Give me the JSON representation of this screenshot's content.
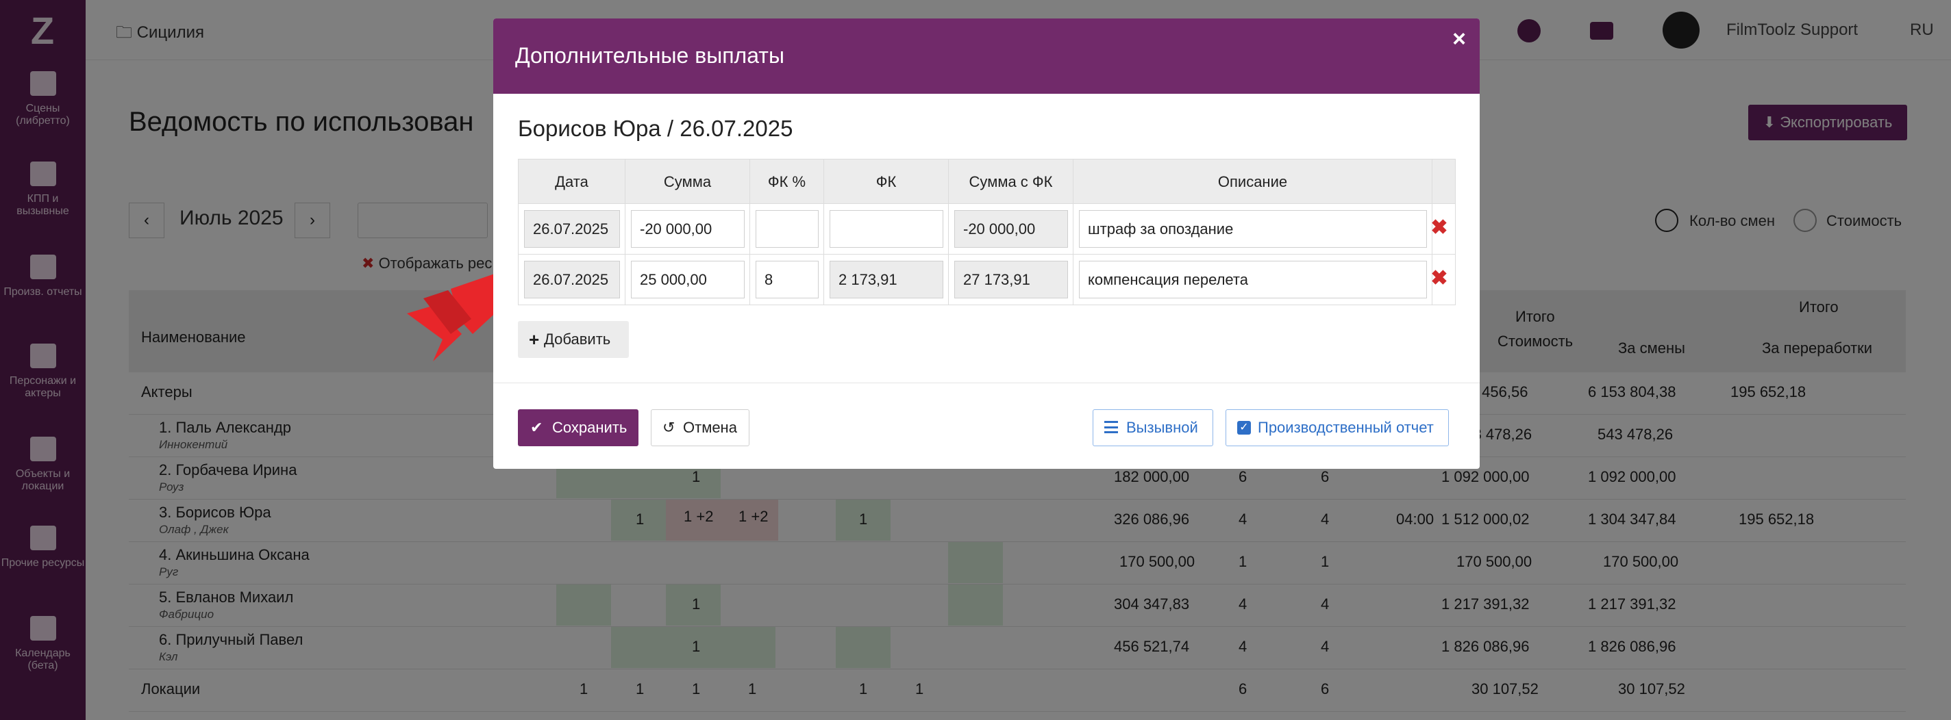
{
  "sidebar": {
    "logo": "Z",
    "items": [
      {
        "label": "Сцены (либретто)",
        "icon": "clapperboard-icon"
      },
      {
        "label": "КПП и вызывные",
        "icon": "calendar-grid-icon"
      },
      {
        "label": "Произв. отчеты",
        "icon": "check-square-icon"
      },
      {
        "label": "Персонажи и актеры",
        "icon": "users-icon"
      },
      {
        "label": "Объекты и локации",
        "icon": "image-icon"
      },
      {
        "label": "Прочие ресурсы",
        "icon": "archive-icon"
      },
      {
        "label": "Календарь (бета)",
        "icon": "calendar-icon"
      }
    ]
  },
  "topbar": {
    "project": "Сицилия",
    "user": "FilmToolz Support",
    "language": "RU"
  },
  "page": {
    "title": "Ведомость по использован",
    "export_label": "Экспортировать",
    "month": "Июль 2025",
    "prev": "‹",
    "next": "›",
    "display_filter": "Отображать рес",
    "radio_shifts": "Кол-во смен",
    "radio_cost": "Стоимость",
    "col_name": "Наименование",
    "col_total": "Итого",
    "col_cost": "Стоимость",
    "col_total2": "Итого",
    "col_shifts": "За смены",
    "col_overtime": "За переработки",
    "rows": [
      {
        "name": "Актеры",
        "sub": "",
        "c1": "",
        "c2": "",
        "c3": "",
        "c4": "",
        "cost": "6 361 456,56",
        "shifts": "6 153 804,38",
        "ot": "195 652,18"
      },
      {
        "name": "1. Паль Александр",
        "sub": "Иннокентий",
        "c1": "",
        "c2": "",
        "c3": "",
        "c4": "",
        "cost": "543 478,26",
        "shifts": "543 478,26",
        "ot": ""
      },
      {
        "name": "2. Горбачева Ирина",
        "sub": "Роуз",
        "c1": "182 000,00",
        "c2": "6",
        "c3": "6",
        "c4": "",
        "cost": "1 092 000,00",
        "shifts": "1 092 000,00",
        "ot": ""
      },
      {
        "name": "3. Борисов Юра",
        "sub": "Олаф , Джек",
        "c1": "326 086,96",
        "c2": "4",
        "c3": "4",
        "c4": "04:00",
        "cost": "1 512 000,02",
        "shifts": "1 304 347,84",
        "ot": "195 652,18"
      },
      {
        "name": "4. Акиньшина Оксана",
        "sub": "Руг",
        "c1": "170 500,00",
        "c2": "1",
        "c3": "1",
        "c4": "",
        "cost": "170 500,00",
        "shifts": "170 500,00",
        "ot": ""
      },
      {
        "name": "5. Евланов Михаил",
        "sub": "Фабрицио",
        "c1": "304 347,83",
        "c2": "4",
        "c3": "4",
        "c4": "",
        "cost": "1 217 391,32",
        "shifts": "1 217 391,32",
        "ot": ""
      },
      {
        "name": "6. Прилучный Павел",
        "sub": "Кэл",
        "c1": "456 521,74",
        "c2": "4",
        "c3": "4",
        "c4": "",
        "cost": "1 826 086,96",
        "shifts": "1 826 086,96",
        "ot": ""
      },
      {
        "name": "Локации",
        "sub": "",
        "c1": "",
        "c2": "6",
        "c3": "6",
        "c4": "",
        "cost": "30 107,52",
        "shifts": "30 107,52",
        "ot": ""
      }
    ],
    "day_marks": {
      "r3": [
        "1",
        "1",
        "1"
      ],
      "r4": [
        "1",
        "1 +2",
        "1 +2",
        "1"
      ],
      "r6": [
        "1"
      ],
      "r7": [
        "1"
      ],
      "r8": [
        "1",
        "1",
        "1",
        "1",
        "1",
        "1"
      ]
    }
  },
  "modal": {
    "title": "Дополнительные выплаты",
    "close": "×",
    "subtitle": "Борисов Юра / 26.07.2025",
    "columns": [
      "Дата",
      "Сумма",
      "ФК %",
      "ФК",
      "Сумма с ФК",
      "Описание"
    ],
    "rows": [
      {
        "date": "26.07.2025",
        "sum": "-20 000,00",
        "fk_pct": "",
        "fk": "",
        "sum_fk": "-20 000,00",
        "desc": "штраф за опоздание"
      },
      {
        "date": "26.07.2025",
        "sum": "25 000,00",
        "fk_pct": "8",
        "fk": "2 173,91",
        "sum_fk": "27 173,91",
        "desc": "компенсация перелета"
      }
    ],
    "delete_glyph": "✖",
    "add_label": "Добавить",
    "save_label": "Сохранить",
    "cancel_label": "Отмена",
    "callsheet_label": "Вызывной",
    "prodreport_label": "Производственный отчет"
  },
  "colors": {
    "brand": "#712a6a",
    "sidebar": "#5c1e54",
    "delete": "#d12b2b",
    "link": "#2e6fc7",
    "accent_red": "#e8262a"
  }
}
